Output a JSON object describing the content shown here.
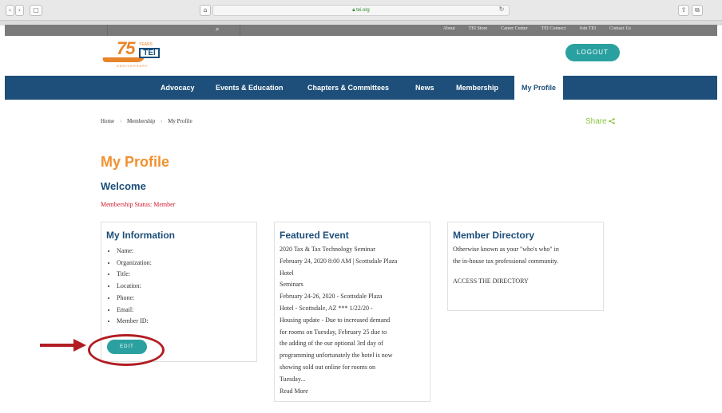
{
  "browser": {
    "url": "tei.org",
    "back_glyph": "‹",
    "forward_glyph": "›",
    "sidebar_glyph": "▢",
    "home_glyph": "⌂",
    "reload_glyph": "↻",
    "share_glyph": "⇪",
    "tabs_glyph": "⧉"
  },
  "utility_bar": {
    "search_glyph": "⌕",
    "links": [
      "About",
      "TEI Store",
      "Career Center",
      "TEI Connect",
      "Join TEI",
      "Contact Us"
    ]
  },
  "header": {
    "logo": {
      "number": "75",
      "years": "YEARS",
      "brand": "TEI",
      "ribbon": "ANNIVERSARY"
    },
    "logout_label": "LOGOUT"
  },
  "main_nav": {
    "items": [
      "Advocacy",
      "Events & Education",
      "Chapters & Committees",
      "News",
      "Membership",
      "My Profile"
    ],
    "active": "My Profile"
  },
  "breadcrumb": [
    "Home",
    "Membership",
    "My Profile"
  ],
  "breadcrumb_separator": "›",
  "share": {
    "label": "Share",
    "icon": "share-icon"
  },
  "page": {
    "title": "My Profile",
    "welcome": "Welcome",
    "membership_status": "Membership Status: Member"
  },
  "my_information": {
    "heading": "My Information",
    "fields": [
      "Name:",
      "Organization:",
      "Title:",
      "Location:",
      "Phone:",
      "Email:",
      "Member ID:"
    ],
    "edit_label": "EDIT"
  },
  "featured_event": {
    "heading": "Featured Event",
    "title": "2020 Tax & Tax Technology Seminar",
    "lines": [
      "February 24, 2020 8:00 AM | Scottsdale Plaza",
      "Hotel",
      "Seminars",
      "February 24-26, 2020 - Scottsdale Plaza",
      "Hotel - Scottsdale, AZ *** 1/22/20 -",
      "Housing update - Due to increased demand",
      "for rooms on Tuesday, February 25 due to",
      "the adding of the our optional 3rd day of",
      "programming unfortunately the hotel is now",
      "showing sold out online for rooms on",
      "Tuesday..."
    ],
    "read_more": "Read More"
  },
  "member_directory": {
    "heading": "Member Directory",
    "lines": [
      "Otherwise known as your \"who's who\" in",
      "the in-house tax professional community."
    ],
    "link": "ACCESS THE DIRECTORY"
  },
  "colors": {
    "nav_blue": "#1d4f7a",
    "teal": "#2aa1a0",
    "orange": "#f0922f",
    "status_red": "#d0172b",
    "annotation_red": "#b11d23",
    "share_green": "#8ac43f"
  }
}
